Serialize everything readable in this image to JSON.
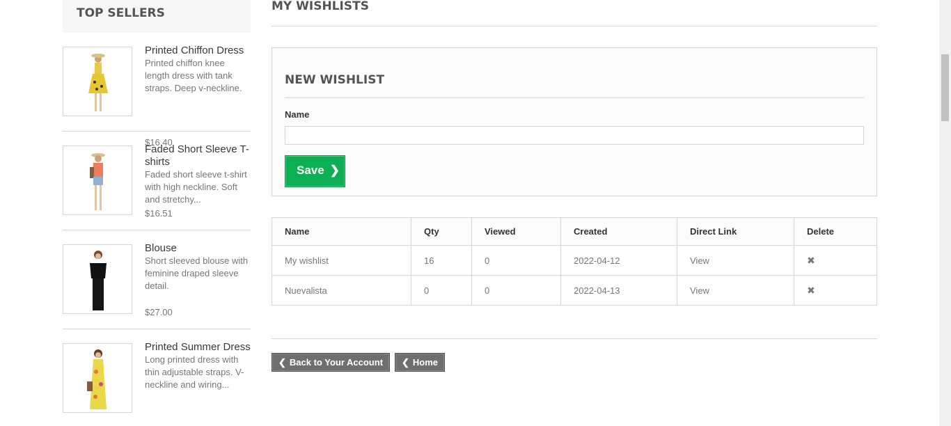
{
  "sidebar": {
    "title": "TOP SELLERS",
    "products": [
      {
        "name": "Printed Chiffon Dress",
        "description": "Printed chiffon knee length dress with tank straps. Deep v-neckline.",
        "price": "$16.40",
        "image_icon": "woman-yellow-dress-image"
      },
      {
        "name": "Faded Short Sleeve T-shirts",
        "description": "Faded short sleeve t-shirt with high neckline. Soft and stretchy...",
        "price": "$16.51",
        "image_icon": "woman-orange-tshirt-image"
      },
      {
        "name": "Blouse",
        "description": "Short sleeved blouse with feminine draped sleeve detail.",
        "price": "$27.00",
        "image_icon": "woman-black-blouse-image"
      },
      {
        "name": "Printed Summer Dress",
        "description": "Long printed dress with thin adjustable straps. V-neckline and wiring...",
        "price": "",
        "image_icon": "woman-summer-dress-image"
      }
    ]
  },
  "main": {
    "title": "MY WISHLISTS",
    "new_wishlist": {
      "heading": "NEW WISHLIST",
      "name_label": "Name",
      "name_value": "",
      "save_label": "Save"
    },
    "table": {
      "headers": [
        "Name",
        "Qty",
        "Viewed",
        "Created",
        "Direct Link",
        "Delete"
      ],
      "rows": [
        {
          "name": "My wishlist",
          "qty": "16",
          "viewed": "0",
          "created": "2022-04-12",
          "link": "View"
        },
        {
          "name": "Nuevalista",
          "qty": "0",
          "viewed": "0",
          "created": "2022-04-13",
          "link": "View"
        }
      ]
    },
    "back_label": "Back to Your Account",
    "home_label": "Home"
  },
  "colors": {
    "save_button": "#0daf54",
    "nav_button": "#6f6f6f",
    "border": "#d6d4d4",
    "heading": "#555454"
  }
}
